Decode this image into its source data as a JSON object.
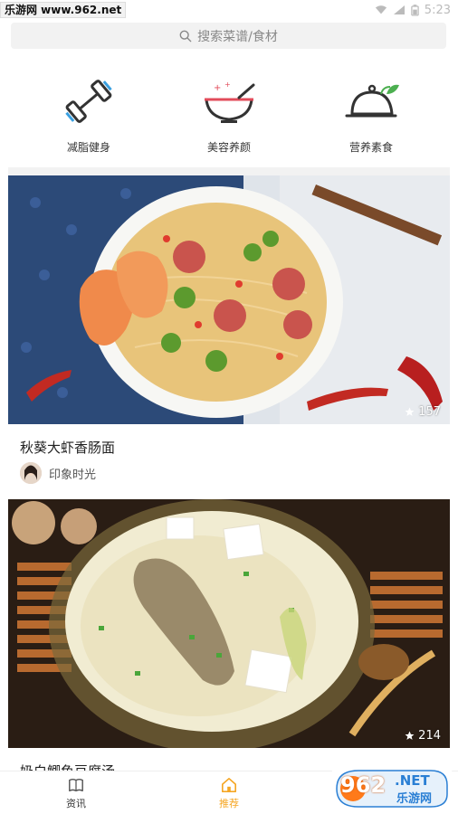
{
  "status_bar": {
    "watermark": "乐游网 www.962.net",
    "time": "5:23"
  },
  "search": {
    "placeholder": "搜索菜谱/食材",
    "icon": "search-icon"
  },
  "categories": [
    {
      "label": "减脂健身",
      "icon": "dumbbell-icon"
    },
    {
      "label": "美容养颜",
      "icon": "bowl-icon"
    },
    {
      "label": "营养素食",
      "icon": "cloche-icon"
    }
  ],
  "recipes": [
    {
      "title": "秋葵大虾香肠面",
      "author": "印象时光",
      "favorites": "157"
    },
    {
      "title": "奶白鲫鱼豆腐汤",
      "favorites": "214"
    }
  ],
  "tabs": [
    {
      "label": "资讯",
      "icon": "book-icon",
      "active": false
    },
    {
      "label": "推荐",
      "icon": "home-icon",
      "active": true
    }
  ],
  "watermark_bottom": {
    "number": "962",
    "suffix": ".NET",
    "name": "乐游网"
  },
  "colors": {
    "accent": "#f5a623",
    "search_bg": "#f2f2f2",
    "divider": "#f2f2f2"
  }
}
